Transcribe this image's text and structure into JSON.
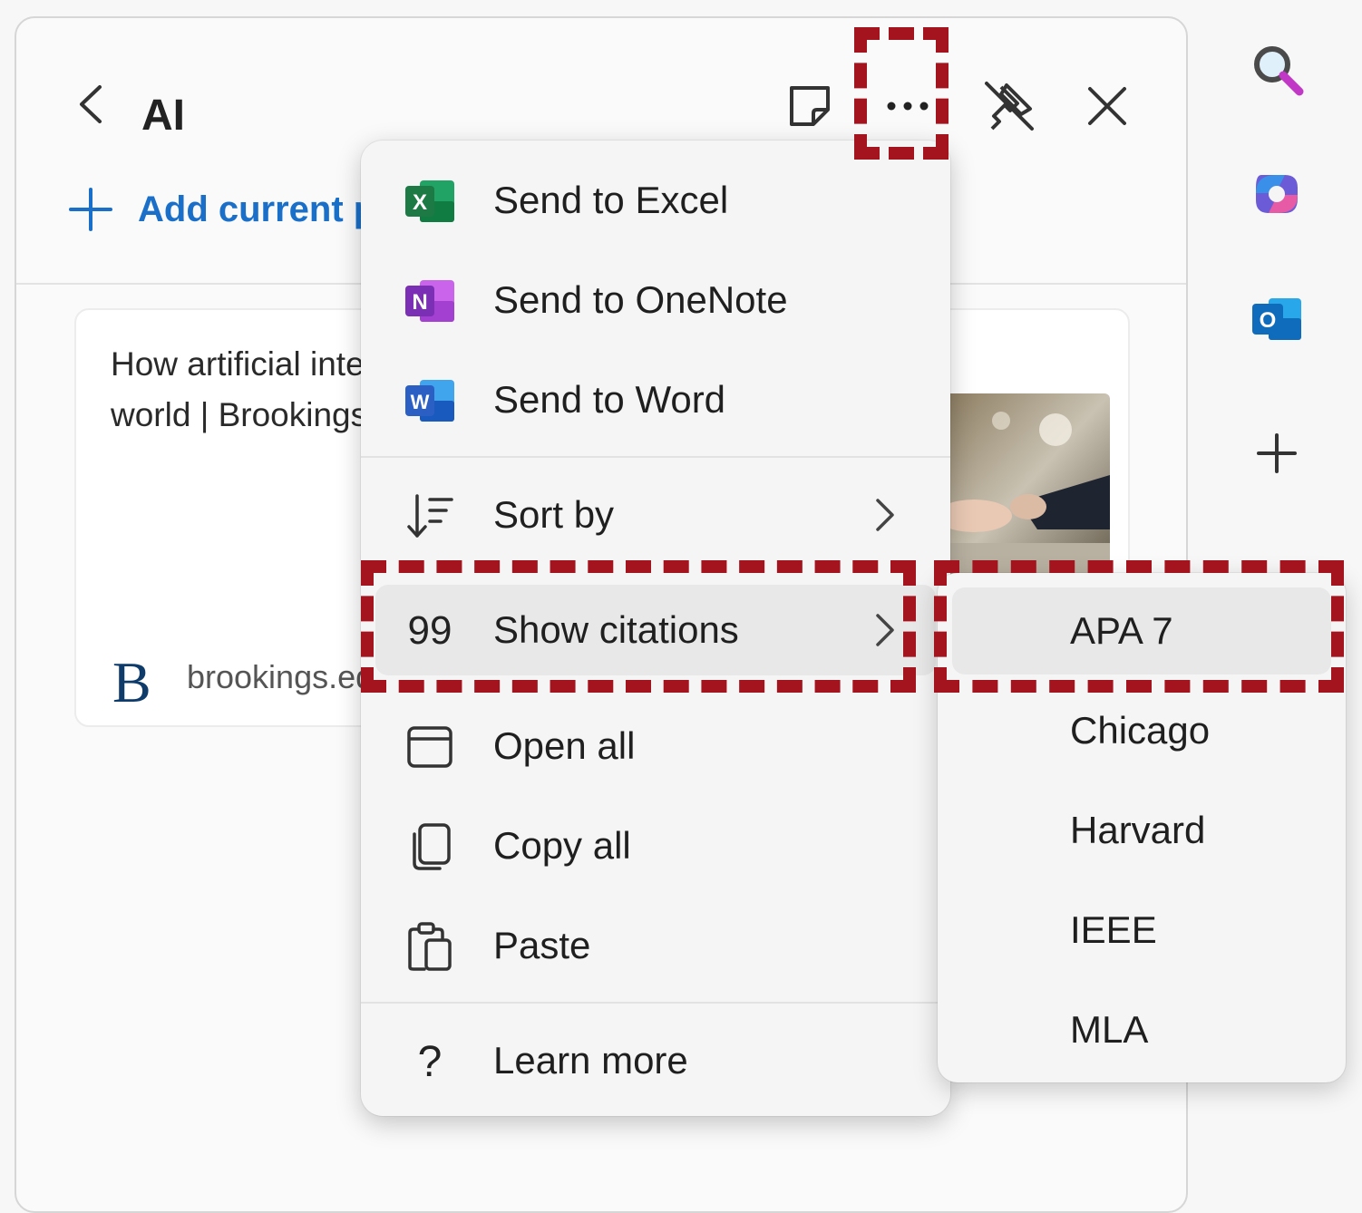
{
  "panel": {
    "title": "AI",
    "add_current_label": "Add current p",
    "card": {
      "title": "How artificial intelligence is transforming the world | Brookings",
      "source": "brookings.edu",
      "logo_letter": "B"
    }
  },
  "menu": {
    "items": [
      {
        "label": "Send to Excel",
        "icon": "excel-icon"
      },
      {
        "label": "Send to OneNote",
        "icon": "onenote-icon"
      },
      {
        "label": "Send to Word",
        "icon": "word-icon"
      },
      {
        "label": "Sort by",
        "icon": "sort-icon",
        "submenu": true
      },
      {
        "label": "Show citations",
        "icon": "quote-icon",
        "submenu": true,
        "highlighted": true
      },
      {
        "label": "Open all",
        "icon": "window-icon"
      },
      {
        "label": "Copy all",
        "icon": "copy-icon"
      },
      {
        "label": "Paste",
        "icon": "paste-icon"
      },
      {
        "label": "Learn more",
        "icon": "question-icon"
      }
    ]
  },
  "citation_submenu": {
    "items": [
      "APA 7",
      "Chicago",
      "Harvard",
      "IEEE",
      "MLA"
    ],
    "highlighted": "APA 7"
  },
  "icon_glyphs": {
    "excel": "X",
    "onenote": "N",
    "word": "W",
    "outlook": "O",
    "quote": "99",
    "question": "?"
  },
  "colors": {
    "accent": "#1a6fc9",
    "callout": "#a4141e",
    "excel": "#1d7a45",
    "onenote": "#7b2fb5",
    "word": "#2b5fc4",
    "outlook": "#0f6cbd"
  }
}
